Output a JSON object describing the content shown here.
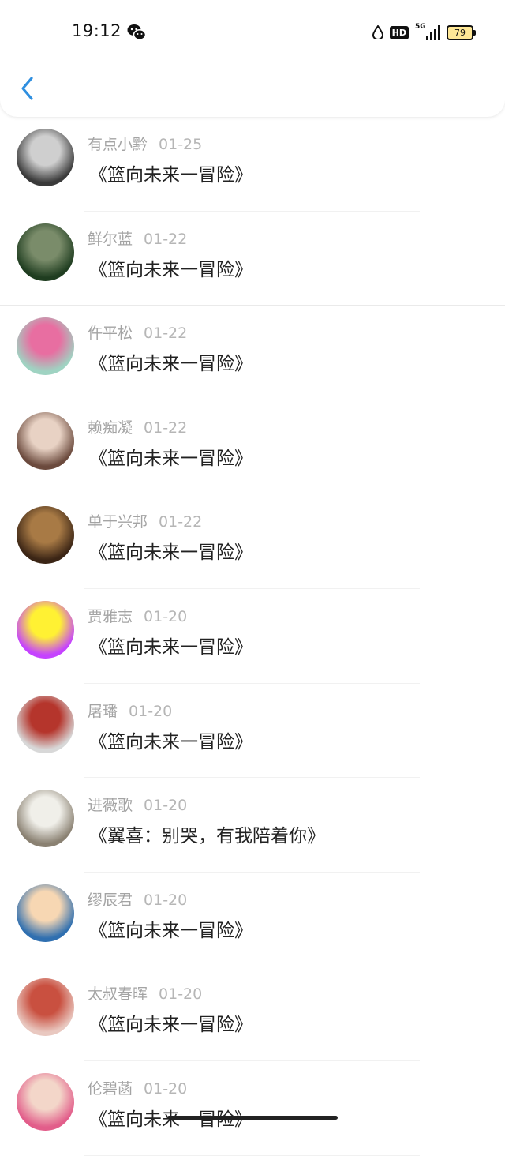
{
  "status_bar": {
    "time": "19:12",
    "hd_label": "HD",
    "network_label": "5G",
    "battery": "79"
  },
  "nav": {
    "back_icon": "chevron-left-icon"
  },
  "messages": [
    {
      "name": "有点小黔",
      "date": "01-25",
      "text": "《篮向未来一冒险》",
      "avatar_colors": [
        "#3a3a3a",
        "#cfcfcf"
      ]
    },
    {
      "name": "鲜尔蓝",
      "date": "01-22",
      "text": "《篮向未来一冒险》",
      "avatar_colors": [
        "#1f3d20",
        "#7a8c6a"
      ]
    },
    {
      "name": "仵平松",
      "date": "01-22",
      "text": "《篮向未来一冒险》",
      "avatar_colors": [
        "#9fd3c2",
        "#e86ea1"
      ]
    },
    {
      "name": "赖痴凝",
      "date": "01-22",
      "text": "《篮向未来一冒险》",
      "avatar_colors": [
        "#6b4a3d",
        "#e8d2c4"
      ]
    },
    {
      "name": "单于兴邦",
      "date": "01-22",
      "text": "《篮向未来一冒险》",
      "avatar_colors": [
        "#3b2515",
        "#a87a45"
      ]
    },
    {
      "name": "贾雅志",
      "date": "01-20",
      "text": "《篮向未来一冒险》",
      "avatar_colors": [
        "#c542ff",
        "#fff133"
      ]
    },
    {
      "name": "屠璠",
      "date": "01-20",
      "text": "《篮向未来一冒险》",
      "avatar_colors": [
        "#d8d8d8",
        "#b5352c"
      ]
    },
    {
      "name": "进薇歌",
      "date": "01-20",
      "text": "《翼喜：别哭，有我陪着你》",
      "avatar_colors": [
        "#8a8172",
        "#f0efe9"
      ]
    },
    {
      "name": "缪辰君",
      "date": "01-20",
      "text": "《篮向未来一冒险》",
      "avatar_colors": [
        "#2f6fb0",
        "#f7d7b3"
      ]
    },
    {
      "name": "太叔春晖",
      "date": "01-20",
      "text": "《篮向未来一冒险》",
      "avatar_colors": [
        "#e9c8c0",
        "#c95040"
      ]
    },
    {
      "name": "伦碧菡",
      "date": "01-20",
      "text": "《篮向未来一冒险》",
      "avatar_colors": [
        "#e25d8a",
        "#f3d6c9"
      ]
    }
  ]
}
